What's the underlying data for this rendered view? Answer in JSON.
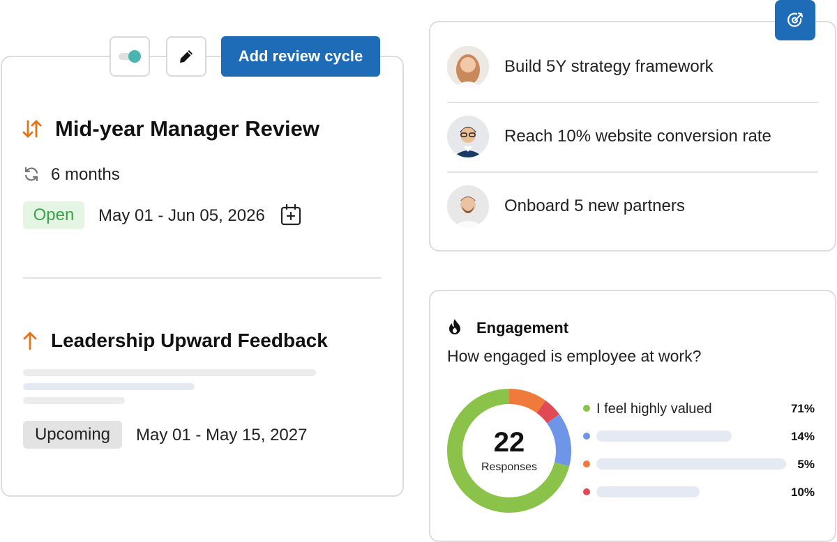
{
  "toolbar": {
    "add_cycle_label": "Add review cycle",
    "toggle_icon": "toggle-on-icon",
    "edit_icon": "pencil-icon",
    "colors": {
      "primary": "#1e6bb8",
      "toggle": "#4ab5b0"
    }
  },
  "review_cycles": [
    {
      "title": "Mid-year Manager Review",
      "icon": "arrows-up-down-icon",
      "frequency_icon": "refresh-icon",
      "frequency": "6 months",
      "status": "Open",
      "dates": "May 01 - Jun 05, 2026",
      "calendar_icon": "calendar-add-icon",
      "colors": {
        "icon": "#e27316",
        "status_bg": "#e4f5e4",
        "status_text": "#3ba34a"
      }
    },
    {
      "title": "Leadership Upward Feedback",
      "icon": "arrow-up-icon",
      "status": "Upcoming",
      "dates": "May 01 - May 15, 2027",
      "colors": {
        "icon": "#e27316",
        "status_bg": "#e3e3e3",
        "status_text": "#222222"
      }
    }
  ],
  "goals": {
    "corner_icon": "target-icon",
    "items": [
      {
        "label": "Build 5Y strategy framework",
        "avatar": "avatar-woman-icon"
      },
      {
        "label": "Reach 10% website conversion rate",
        "avatar": "avatar-man-glasses-icon"
      },
      {
        "label": "Onboard 5 new partners",
        "avatar": "avatar-man-beard-icon"
      }
    ]
  },
  "engagement": {
    "icon": "flame-icon",
    "title": "Engagement",
    "question": "How engaged is employee at work?",
    "responses_count": "22",
    "responses_label": "Responses"
  },
  "chart_data": {
    "type": "pie",
    "donut": true,
    "center_value": "22",
    "center_label": "Responses",
    "slices": [
      {
        "label": "I feel highly valued",
        "value": 71,
        "display": "71%",
        "color": "#8bc24a"
      },
      {
        "label": "",
        "value": 14,
        "display": "14%",
        "color": "#6f95e8"
      },
      {
        "label": "",
        "value": 5,
        "display": "5%",
        "color": "#e04a55"
      },
      {
        "label": "",
        "value": 10,
        "display": "10%",
        "color": "#f07a3c"
      }
    ],
    "legend_placement": "right"
  }
}
